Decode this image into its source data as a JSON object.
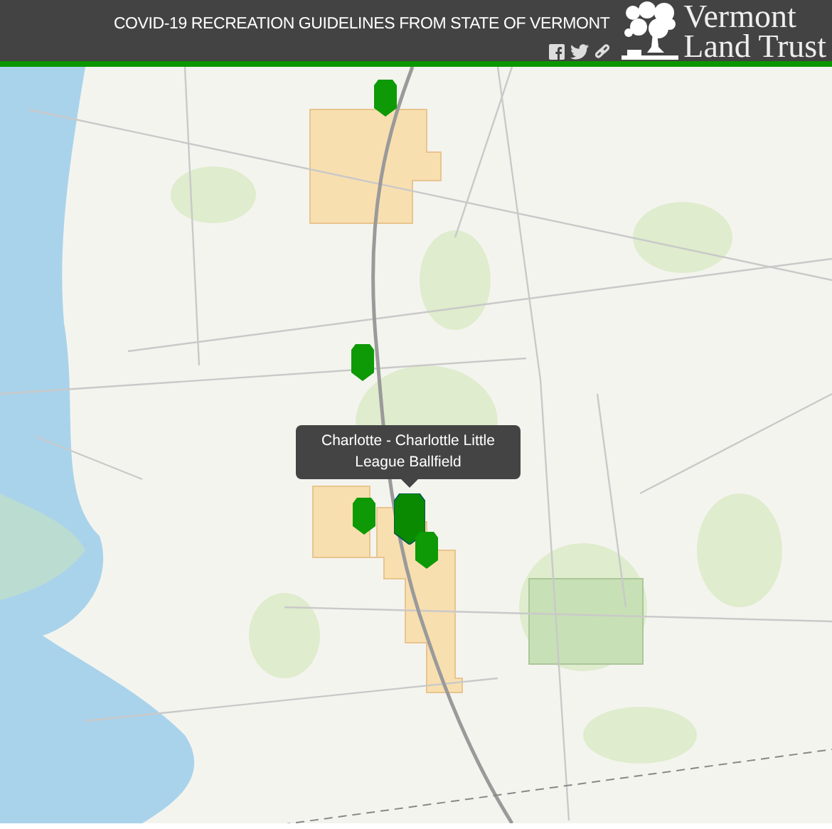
{
  "header": {
    "title": "COVID-19 RECREATION GUIDELINES FROM STATE OF VERMONT",
    "logo_text": [
      "Vermont",
      "Land Trust"
    ]
  },
  "map": {
    "markers": [
      {
        "selected": false
      },
      {
        "selected": false
      },
      {
        "selected": false
      },
      {
        "selected": true
      },
      {
        "selected": false
      }
    ],
    "tooltip": "Charlotte - Charlottle Little League Ballfield"
  }
}
